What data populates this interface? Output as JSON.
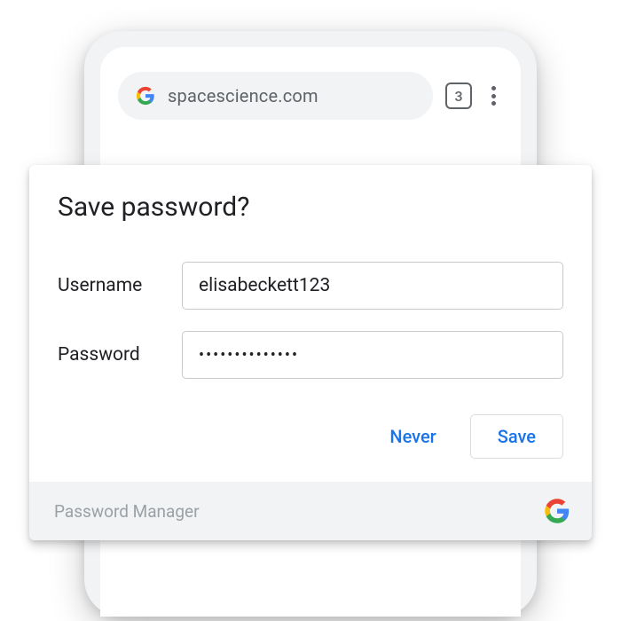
{
  "browser": {
    "url": "spacescience.com",
    "tab_count": "3"
  },
  "dialog": {
    "title": "Save password?",
    "username_label": "Username",
    "username_value": "elisabeckett123",
    "password_label": "Password",
    "password_value": "••••••••••••••",
    "never_label": "Never",
    "save_label": "Save"
  },
  "footer": {
    "label": "Password Manager"
  }
}
